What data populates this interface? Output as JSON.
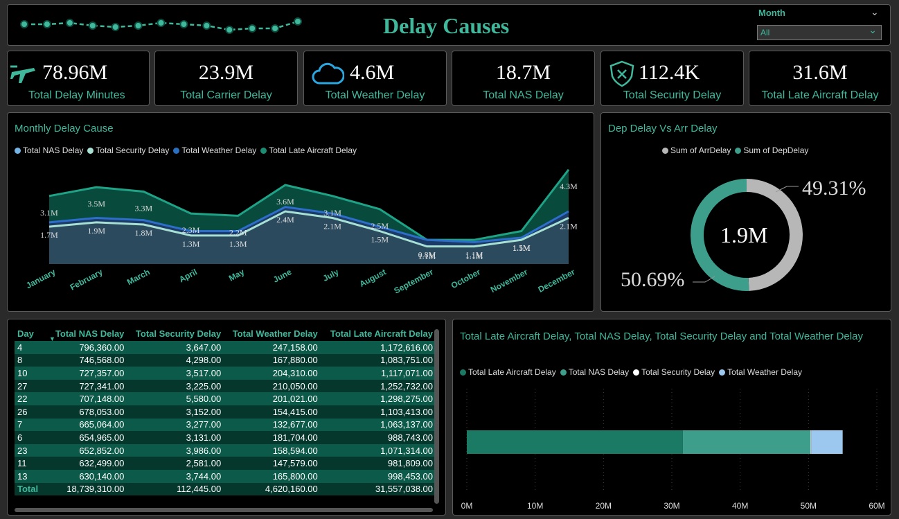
{
  "header": {
    "title": "Delay Causes",
    "filter_label": "Month",
    "filter_value": "All",
    "sparkline": [
      38,
      38,
      36,
      40,
      42,
      40,
      36,
      38,
      40,
      46,
      44,
      44,
      34
    ]
  },
  "kpis": [
    {
      "value": "78.96M",
      "label": "Total Delay Minutes",
      "icon": "airplane-icon"
    },
    {
      "value": "23.9M",
      "label": "Total Carrier Delay",
      "icon": ""
    },
    {
      "value": "4.6M",
      "label": "Total Weather Delay",
      "icon": "cloud-icon"
    },
    {
      "value": "18.7M",
      "label": "Total NAS Delay",
      "icon": ""
    },
    {
      "value": "112.4K",
      "label": "Total Security Delay",
      "icon": "shield-icon"
    },
    {
      "value": "31.6M",
      "label": "Total Late Aircraft Delay",
      "icon": ""
    }
  ],
  "colors": {
    "nas": "#74b3e6",
    "security": "#a8e0d4",
    "weather": "#2a6fbf",
    "late": "#1a8c72",
    "accent": "#3fb89c",
    "arr": "#b7b7b7",
    "dep": "#3c9e8b"
  },
  "monthly": {
    "title": "Monthly Delay Cause",
    "legend": [
      "Total NAS Delay",
      "Total Security Delay",
      "Total Weather Delay",
      "Total Late Aircraft Delay"
    ],
    "chart_data": {
      "type": "area",
      "x": [
        "January",
        "February",
        "March",
        "April",
        "May",
        "June",
        "July",
        "August",
        "September",
        "October",
        "November",
        "December"
      ],
      "series": [
        {
          "name": "Total Late Aircraft Delay",
          "values": [
            3.1,
            3.5,
            3.3,
            2.3,
            2.2,
            3.6,
            3.1,
            2.5,
            1.1,
            1.1,
            1.5,
            4.3
          ]
        },
        {
          "name": "Total Weather Delay",
          "values": [
            1.9,
            2.1,
            2.0,
            1.5,
            1.5,
            2.6,
            2.3,
            1.7,
            1.1,
            1.0,
            1.2,
            2.4
          ]
        },
        {
          "name": "Total Security Delay",
          "values": [
            1.7,
            1.9,
            1.8,
            1.3,
            1.3,
            2.4,
            2.1,
            1.5,
            0.8,
            0.8,
            1.1,
            2.1
          ]
        }
      ],
      "labels_top": [
        "3.1M",
        "3.5M",
        "3.3M",
        "2.3M",
        "2.2M",
        "3.6M",
        "3.1M",
        "2.5M",
        "1.1M",
        "1.1M",
        "1.5M",
        "4.3M"
      ],
      "labels_bottom": [
        "1.7M",
        "1.9M",
        "1.8M",
        "1.3M",
        "1.3M",
        "2.4M",
        "2.1M",
        "1.5M",
        "0.8M",
        "1.1M",
        "1.1M",
        "2.1M"
      ],
      "ylim": [
        0,
        4.8
      ]
    }
  },
  "donut": {
    "title": "Dep Delay Vs Arr Delay",
    "legend": [
      "Sum of ArrDelay",
      "Sum of DepDelay"
    ],
    "center": "1.9M",
    "chart_data": {
      "type": "pie",
      "categories": [
        "Sum of ArrDelay",
        "Sum of DepDelay"
      ],
      "values": [
        49.31,
        50.69
      ]
    },
    "label_arr": "49.31%",
    "label_dep": "50.69%"
  },
  "table": {
    "headers": [
      "Day",
      "Total NAS Delay",
      "Total Security Delay",
      "Total Weather Delay",
      "Total Late Aircraft Delay"
    ],
    "rows": [
      [
        "4",
        "796,360.00",
        "3,647.00",
        "247,158.00",
        "1,172,616.00"
      ],
      [
        "8",
        "746,568.00",
        "4,298.00",
        "167,880.00",
        "1,083,751.00"
      ],
      [
        "10",
        "727,357.00",
        "3,517.00",
        "204,310.00",
        "1,117,071.00"
      ],
      [
        "27",
        "727,341.00",
        "3,225.00",
        "210,050.00",
        "1,252,732.00"
      ],
      [
        "22",
        "707,148.00",
        "5,580.00",
        "201,021.00",
        "1,298,275.00"
      ],
      [
        "26",
        "678,053.00",
        "3,152.00",
        "154,415.00",
        "1,103,413.00"
      ],
      [
        "7",
        "665,064.00",
        "3,277.00",
        "132,677.00",
        "1,063,137.00"
      ],
      [
        "6",
        "654,965.00",
        "3,131.00",
        "181,704.00",
        "988,743.00"
      ],
      [
        "23",
        "652,852.00",
        "3,986.00",
        "158,594.00",
        "1,071,314.00"
      ],
      [
        "11",
        "632,499.00",
        "2,581.00",
        "147,579.00",
        "981,809.00"
      ],
      [
        "13",
        "630,140.00",
        "3,744.00",
        "165,800.00",
        "998,453.00"
      ]
    ],
    "total": [
      "Total",
      "18,739,310.00",
      "112,445.00",
      "4,620,160.00",
      "31,557,038.00"
    ]
  },
  "bar": {
    "title": "Total Late Aircraft Delay, Total NAS Delay, Total Security Delay and Total Weather Delay",
    "legend": [
      "Total Late Aircraft Delay",
      "Total NAS Delay",
      "Total Security Delay",
      "Total Weather Delay"
    ],
    "chart_data": {
      "type": "bar",
      "series": [
        {
          "name": "Total Late Aircraft Delay",
          "values": [
            31.6
          ]
        },
        {
          "name": "Total NAS Delay",
          "values": [
            18.7
          ]
        },
        {
          "name": "Total Security Delay",
          "values": [
            0.1
          ]
        },
        {
          "name": "Total Weather Delay",
          "values": [
            4.6
          ]
        }
      ],
      "xlim": [
        0,
        60
      ],
      "ticks": [
        "0M",
        "10M",
        "20M",
        "30M",
        "40M",
        "50M",
        "60M"
      ]
    }
  }
}
